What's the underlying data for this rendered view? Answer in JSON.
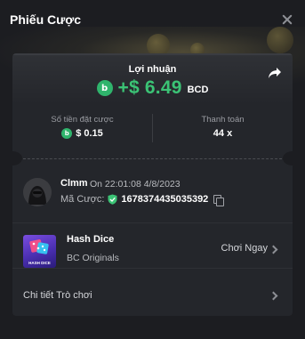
{
  "header": {
    "title": "Phiếu Cược"
  },
  "profit": {
    "label": "Lợi nhuận",
    "amount": "+$ 6.49",
    "currency": "BCD",
    "coin_symbol": "b"
  },
  "stats": {
    "bet_amount_label": "Số tiền đặt cược",
    "bet_amount_value": "$ 0.15",
    "payout_label": "Thanh toán",
    "payout_value": "44 x"
  },
  "bet": {
    "username": "Clmm",
    "datetime": "On 22:01:08 4/8/2023",
    "bet_id_label": "Mã Cược:",
    "bet_id_value": "1678374435035392"
  },
  "game": {
    "name": "Hash Dice",
    "provider": "BC Originals",
    "play_label": "Chơi Ngay",
    "thumb_label": "HASH DICE"
  },
  "details": {
    "label": "Chi tiết Trò chơi"
  },
  "colors": {
    "accent_green": "#3bc375",
    "coin_green": "#2fb46c",
    "background": "#1c1d21",
    "card": "#24262b"
  }
}
